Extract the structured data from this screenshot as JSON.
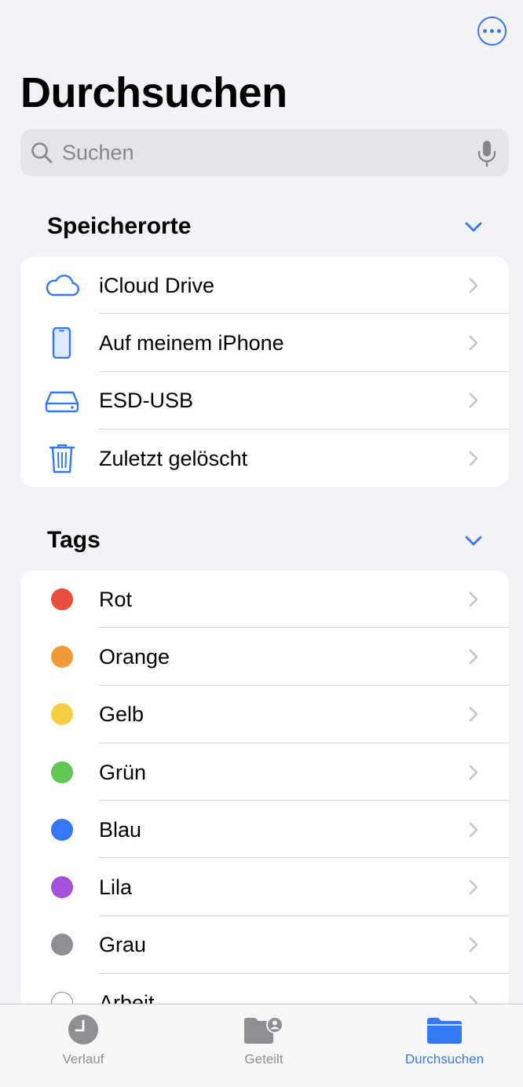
{
  "header": {
    "title": "Durchsuchen",
    "more_icon": "ellipsis-circle-icon"
  },
  "search": {
    "placeholder": "Suchen",
    "search_icon": "magnifier-icon",
    "mic_icon": "microphone-icon"
  },
  "locations": {
    "header": "Speicherorte",
    "items": [
      {
        "label": "iCloud Drive",
        "icon": "cloud-icon"
      },
      {
        "label": "Auf meinem iPhone",
        "icon": "iphone-icon"
      },
      {
        "label": "ESD-USB",
        "icon": "external-drive-icon"
      },
      {
        "label": "Zuletzt gelöscht",
        "icon": "trash-icon"
      }
    ]
  },
  "tags": {
    "header": "Tags",
    "items": [
      {
        "label": "Rot",
        "color": "#eb4d3d"
      },
      {
        "label": "Orange",
        "color": "#f19a37"
      },
      {
        "label": "Gelb",
        "color": "#f8cd46"
      },
      {
        "label": "Grün",
        "color": "#62c554"
      },
      {
        "label": "Blau",
        "color": "#3478f6"
      },
      {
        "label": "Lila",
        "color": "#a550da"
      },
      {
        "label": "Grau",
        "color": "#8e8e93"
      },
      {
        "label": "Arbeit",
        "color": "none"
      }
    ]
  },
  "tabbar": {
    "tabs": [
      {
        "label": "Verlauf",
        "icon": "clock-icon",
        "active": false
      },
      {
        "label": "Geteilt",
        "icon": "shared-folder-icon",
        "active": false
      },
      {
        "label": "Durchsuchen",
        "icon": "folder-icon",
        "active": true
      }
    ]
  },
  "colors": {
    "accent": "#3478f6",
    "background": "#f2f2f7",
    "inactive": "#8e8e93"
  }
}
